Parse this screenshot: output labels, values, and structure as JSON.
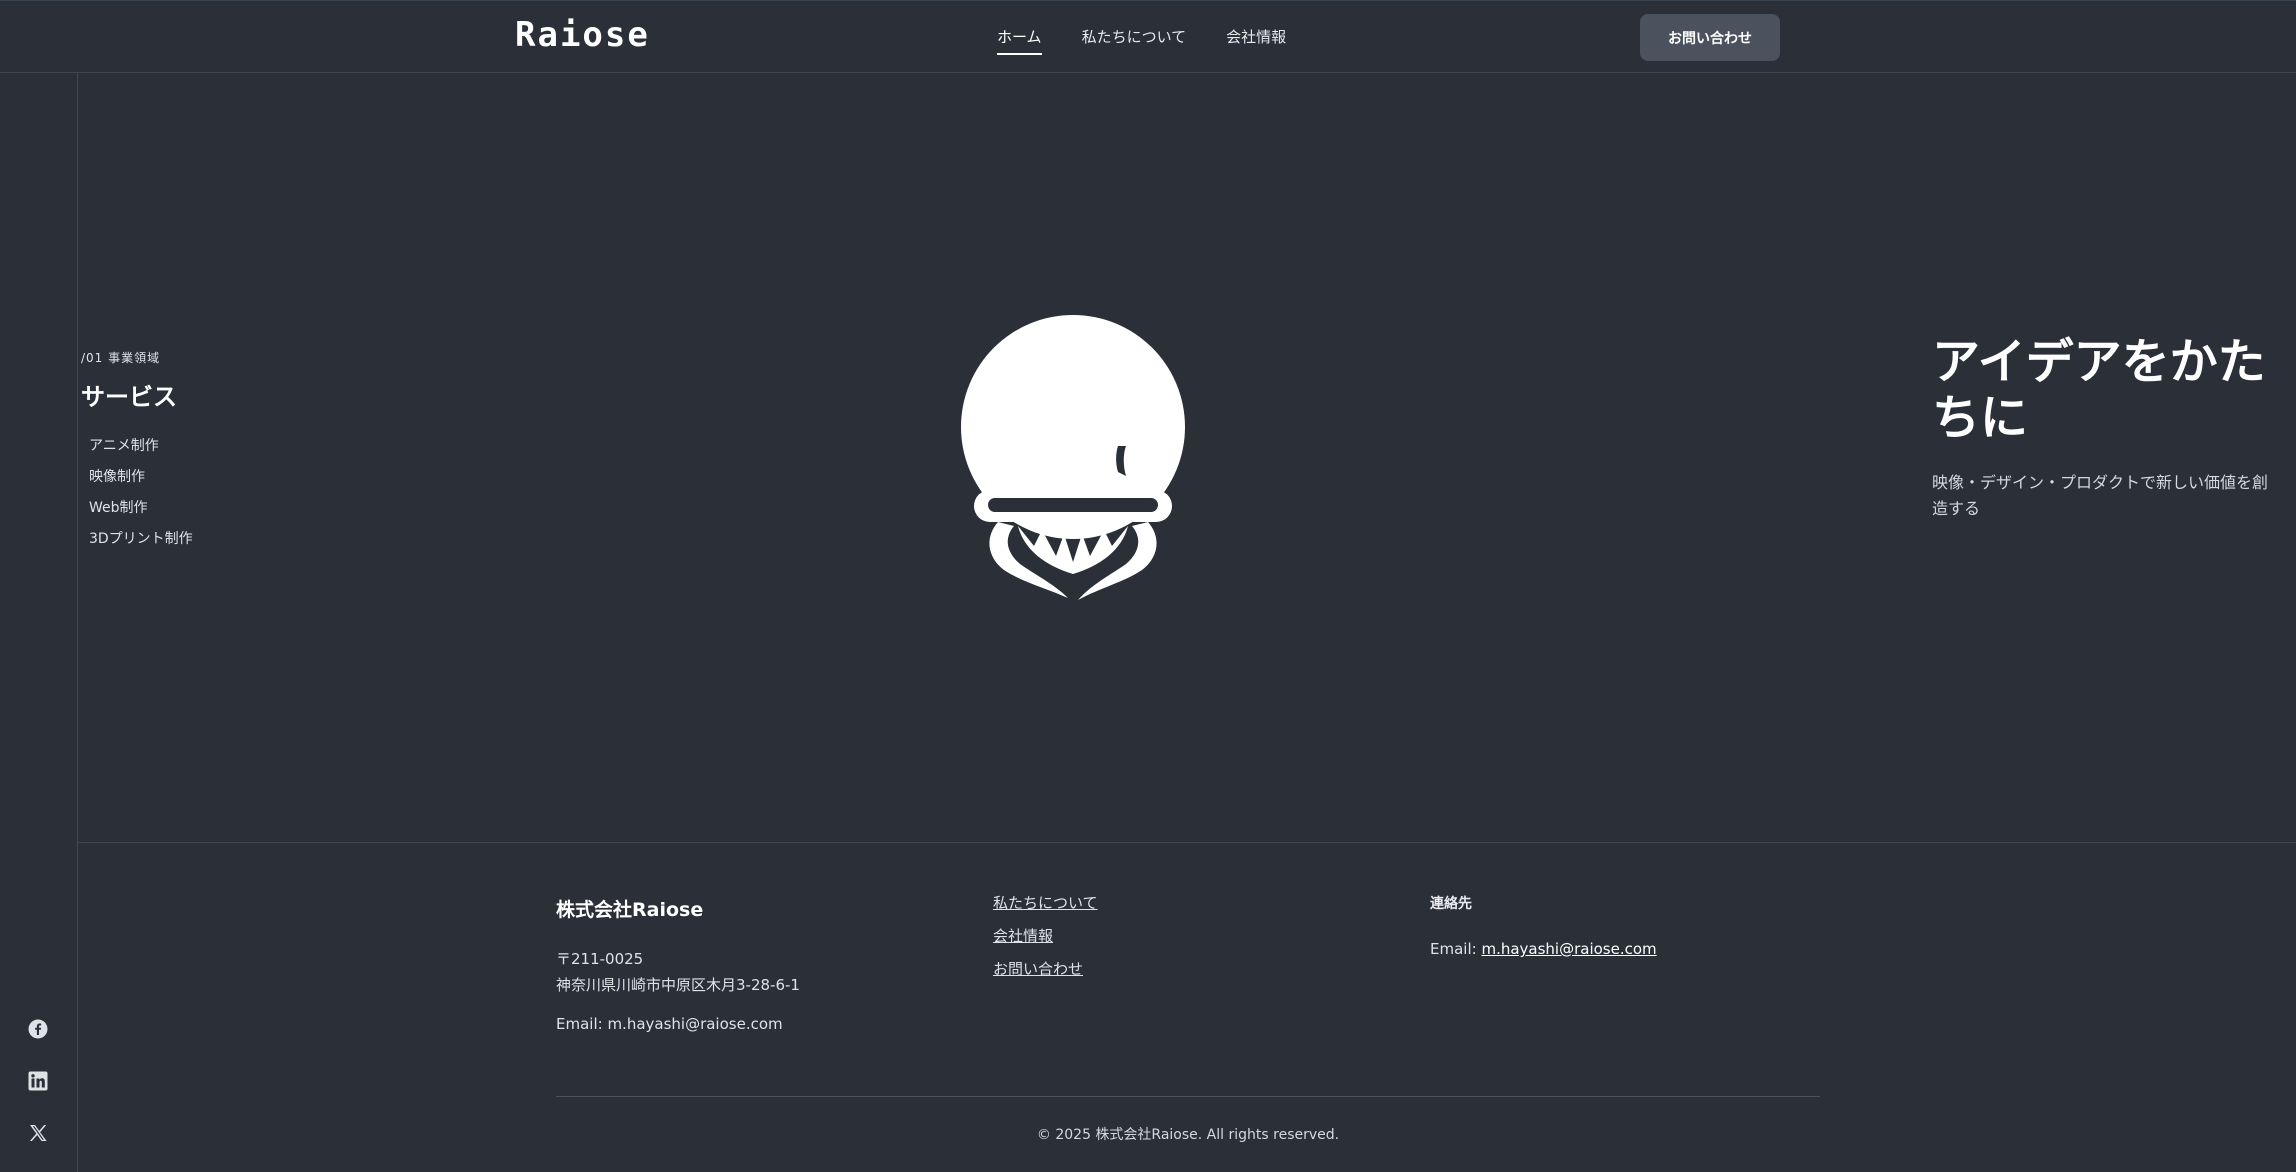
{
  "header": {
    "logo_text": "Raiose",
    "nav": [
      {
        "label": "ホーム",
        "active": true
      },
      {
        "label": "私たちについて",
        "active": false
      },
      {
        "label": "会社情報",
        "active": false
      }
    ],
    "contact_button": "お問い合わせ"
  },
  "social": [
    {
      "icon": "facebook-icon"
    },
    {
      "icon": "linkedin-icon"
    },
    {
      "icon": "x-icon"
    }
  ],
  "services": {
    "eyebrow": "/01 事業領域",
    "title": "サービス",
    "items": [
      "アニメ制作",
      "映像制作",
      "Web制作",
      "3Dプリント制作"
    ]
  },
  "hero": {
    "title": "アイデアをかたちに",
    "subtitle": "映像・デザイン・プロダクトで新しい価値を創造する"
  },
  "footer": {
    "company_name": "株式会社Raiose",
    "postal": "〒211-0025",
    "address": "神奈川県川崎市中原区木月3-28-6-1",
    "email_line": "Email: m.hayashi@raiose.com",
    "links": [
      "私たちについて",
      "会社情報",
      "お問い合わせ"
    ],
    "contact_heading": "連絡先",
    "contact_email_prefix": "Email: ",
    "contact_email": "m.hayashi@raiose.com",
    "copyright": "© 2025 株式会社Raiose. All rights reserved."
  },
  "colors": {
    "background": "#2a2f38",
    "button": "#4b525e",
    "divider": "#3f4754",
    "text": "#e9ebee"
  }
}
